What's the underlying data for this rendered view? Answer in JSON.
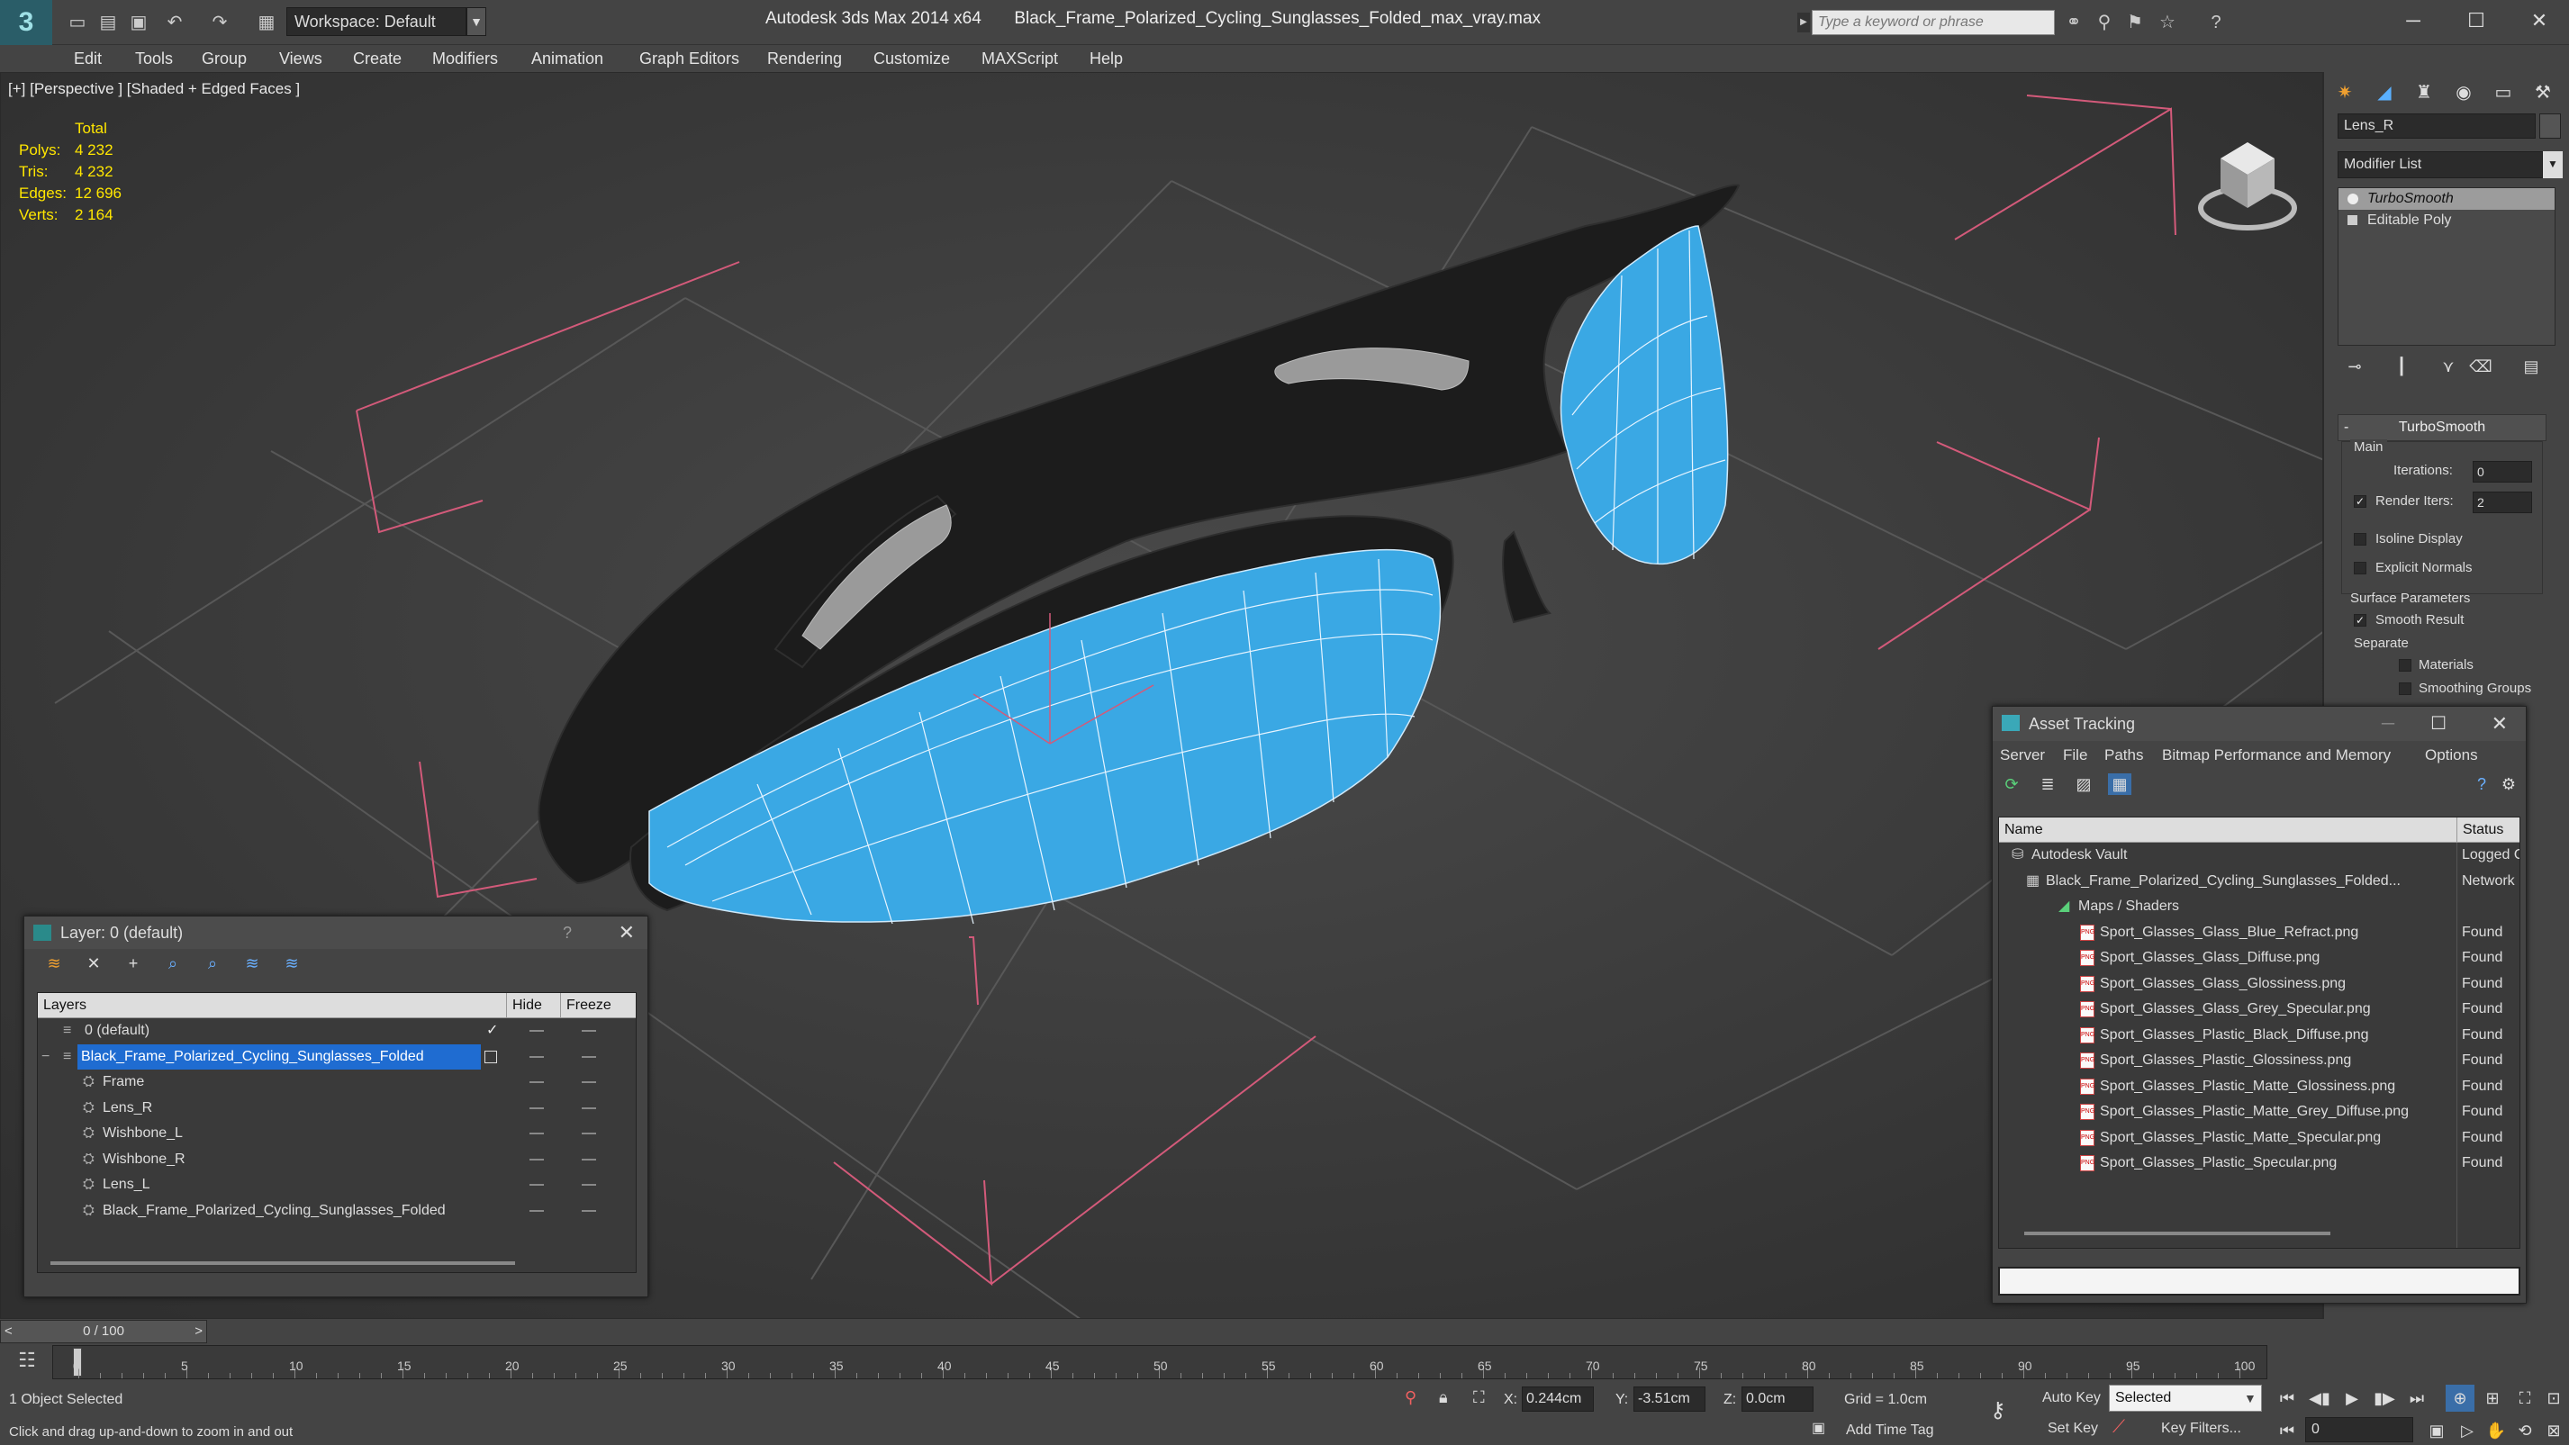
{
  "window": {
    "app_title": "Autodesk 3ds Max  2014 x64",
    "file_title": "Black_Frame_Polarized_Cycling_Sunglasses_Folded_max_vray.max",
    "workspace": "Workspace: Default",
    "search_placeholder": "Type a keyword or phrase"
  },
  "menu": [
    "Edit",
    "Tools",
    "Group",
    "Views",
    "Create",
    "Modifiers",
    "Animation",
    "Graph Editors",
    "Rendering",
    "Customize",
    "MAXScript",
    "Help"
  ],
  "viewport": {
    "label": "[+] [Perspective ] [Shaded + Edged Faces ]",
    "stats": {
      "header": "Total",
      "rows": [
        {
          "label": "Polys:",
          "value": "4 232"
        },
        {
          "label": "Tris:",
          "value": "4 232"
        },
        {
          "label": "Edges:",
          "value": "12 696"
        },
        {
          "label": "Verts:",
          "value": "2 164"
        }
      ]
    },
    "colors": {
      "lens": "#3aa8e4",
      "frame": "#1c1c1c",
      "grid": "#5a5a5a",
      "gizmo": "#d35a7a",
      "stats": "#ffe600"
    }
  },
  "command_panel": {
    "object_name": "Lens_R",
    "modifier_list": "Modifier List",
    "stack": [
      "TurboSmooth",
      "Editable Poly"
    ],
    "rollout_title": "TurboSmooth",
    "main_label": "Main",
    "iterations_label": "Iterations:",
    "iterations_value": "0",
    "render_iters_label": "Render Iters:",
    "render_iters_value": "2",
    "isoline": "Isoline Display",
    "explicit": "Explicit Normals",
    "surface_params": "Surface Parameters",
    "smooth_result": "Smooth Result",
    "separate": "Separate",
    "materials": "Materials",
    "smoothing_groups": "Smoothing Groups"
  },
  "layer_dialog": {
    "title": "Layer: 0 (default)",
    "help": "?",
    "columns": {
      "layers": "Layers",
      "hide": "Hide",
      "freeze": "Freeze"
    },
    "rows": [
      {
        "name": "0 (default)",
        "level": 0
      },
      {
        "name": "Black_Frame_Polarized_Cycling_Sunglasses_Folded",
        "level": 0
      },
      {
        "name": "Frame",
        "level": 1
      },
      {
        "name": "Lens_R",
        "level": 1
      },
      {
        "name": "Wishbone_L",
        "level": 1
      },
      {
        "name": "Wishbone_R",
        "level": 1
      },
      {
        "name": "Lens_L",
        "level": 1
      },
      {
        "name": "Black_Frame_Polarized_Cycling_Sunglasses_Folded",
        "level": 1
      }
    ]
  },
  "asset_dialog": {
    "title": "Asset Tracking",
    "menu": [
      "Server",
      "File",
      "Paths",
      "Bitmap Performance and Memory",
      "Options"
    ],
    "columns": {
      "name": "Name",
      "status": "Status"
    },
    "rows": [
      {
        "name": "Autodesk Vault",
        "status": "Logged O",
        "level": 0
      },
      {
        "name": "Black_Frame_Polarized_Cycling_Sunglasses_Folded...",
        "status": "Network",
        "level": 1
      },
      {
        "name": "Maps / Shaders",
        "status": "",
        "level": 2
      },
      {
        "name": "Sport_Glasses_Glass_Blue_Refract.png",
        "status": "Found",
        "level": 3
      },
      {
        "name": "Sport_Glasses_Glass_Diffuse.png",
        "status": "Found",
        "level": 3
      },
      {
        "name": "Sport_Glasses_Glass_Glossiness.png",
        "status": "Found",
        "level": 3
      },
      {
        "name": "Sport_Glasses_Glass_Grey_Specular.png",
        "status": "Found",
        "level": 3
      },
      {
        "name": "Sport_Glasses_Plastic_Black_Diffuse.png",
        "status": "Found",
        "level": 3
      },
      {
        "name": "Sport_Glasses_Plastic_Glossiness.png",
        "status": "Found",
        "level": 3
      },
      {
        "name": "Sport_Glasses_Plastic_Matte_Glossiness.png",
        "status": "Found",
        "level": 3
      },
      {
        "name": "Sport_Glasses_Plastic_Matte_Grey_Diffuse.png",
        "status": "Found",
        "level": 3
      },
      {
        "name": "Sport_Glasses_Plastic_Matte_Specular.png",
        "status": "Found",
        "level": 3
      },
      {
        "name": "Sport_Glasses_Plastic_Specular.png",
        "status": "Found",
        "level": 3
      }
    ]
  },
  "timeline": {
    "frame_readout": "0 / 100",
    "ticks": [
      "0",
      "5",
      "10",
      "15",
      "20",
      "25",
      "30",
      "35",
      "40",
      "45",
      "50",
      "55",
      "60",
      "65",
      "70",
      "75",
      "80",
      "85",
      "90",
      "95",
      "100"
    ]
  },
  "status": {
    "selection": "1 Object Selected",
    "prompt": "Click and drag up-and-down to zoom in and out",
    "x_label": "X:",
    "x_value": "0.244cm",
    "y_label": "Y:",
    "y_value": "-3.51cm",
    "z_label": "Z:",
    "z_value": "0.0cm",
    "grid": "Grid = 1.0cm",
    "add_time_tag": "Add Time Tag",
    "auto_key": "Auto Key",
    "set_key": "Set Key",
    "selected_option": "Selected",
    "key_filters": "Key Filters...",
    "frame_value": "0"
  }
}
